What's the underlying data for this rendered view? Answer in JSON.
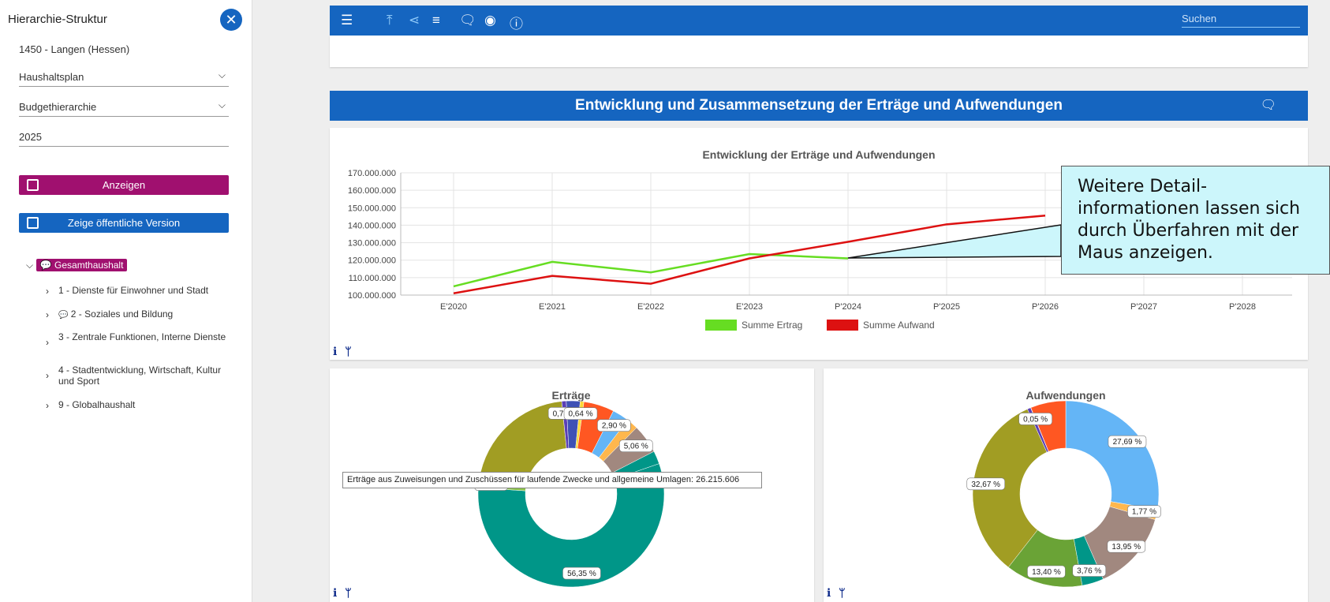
{
  "sidebar": {
    "title": "Hierarchie-Struktur",
    "municipality": "1450 - Langen (Hessen)",
    "plan_select": "Haushaltsplan",
    "hierarchy_select": "Budgethierarchie",
    "year_field": "2025",
    "show_button": "Anzeigen",
    "public_button": "Zeige öffentliche Version",
    "tree": {
      "root": "Gesamthaushalt",
      "items": [
        "1 - Dienste für Einwohner und Stadt",
        "2 - Soziales und Bildung",
        "3 - Zentrale Funktionen, Interne Dienste",
        "4 - Stadtentwicklung, Wirtschaft, Kultur und Sport",
        "9 - Globalhaushalt"
      ]
    }
  },
  "toolbar": {
    "search_placeholder": "Suchen",
    "icons": [
      "menu-icon",
      "upload-icon",
      "share-icon",
      "list-icon",
      "comment-icon",
      "eye-icon",
      "info-icon"
    ]
  },
  "section": {
    "title": "Entwicklung und Zusammensetzung der Erträge und Aufwendungen"
  },
  "callout_text": "Weitere Detail-informationen lassen sich durch Überfahren mit der Maus anzeigen.",
  "callout_lines": [
    "Weitere Detail-",
    "informationen lassen sich",
    "durch Überfahren mit der",
    "Maus anzeigen."
  ],
  "tooltip_text": "Erträge aus Zuweisungen und Zuschüssen für laufende Zwecke und allgemeine Umlagen: 26.215.606",
  "colors": {
    "primary": "#1565c0",
    "accent": "#a0106f",
    "ertrag": "#66dd22",
    "aufwand": "#dd1111"
  },
  "chart_data": [
    {
      "type": "line",
      "title": "Entwicklung der Erträge und Aufwendungen",
      "categories": [
        "E'2020",
        "E'2021",
        "E'2022",
        "E'2023",
        "P'2024",
        "P'2025",
        "P'2026",
        "P'2027",
        "P'2028"
      ],
      "ylim": [
        100000000,
        170000000
      ],
      "yticks": [
        "100.000.000",
        "110.000.000",
        "120.000.000",
        "130.000.000",
        "140.000.000",
        "150.000.000",
        "160.000.000",
        "170.000.000"
      ],
      "series": [
        {
          "name": "Summe Ertrag",
          "color": "#66dd22",
          "values": [
            105000000,
            119000000,
            113000000,
            123500000,
            121000000,
            null,
            null,
            null,
            null
          ]
        },
        {
          "name": "Summe Aufwand",
          "color": "#dd1111",
          "values": [
            101000000,
            111000000,
            106500000,
            121000000,
            130500000,
            140500000,
            145500000,
            null,
            null
          ]
        }
      ],
      "legend": "bottom",
      "grid": true
    },
    {
      "type": "pie",
      "title": "Erträge",
      "slices": [
        {
          "value": 56.35,
          "label": "56,35 %",
          "color": "#009688"
        },
        {
          "value": 1.44,
          "label": "1,44 %",
          "color": "#8bc34a"
        },
        {
          "value": 20.87,
          "label": "",
          "color": "#a19d23"
        },
        {
          "value": 0.78,
          "label": "0,78 %",
          "color": "#5a3fb5"
        },
        {
          "value": 2.4,
          "label": "",
          "color": "#3f51b5"
        },
        {
          "value": 0.64,
          "label": "0,64 %",
          "color": "#fdd835"
        },
        {
          "value": 5.3,
          "label": "",
          "color": "#ff5722"
        },
        {
          "value": 2.9,
          "label": "2,90 %",
          "color": "#64b5f6"
        },
        {
          "value": 2.0,
          "label": "",
          "color": "#ffb74d"
        },
        {
          "value": 5.06,
          "label": "5,06 %",
          "color": "#a1887f"
        },
        {
          "value": 2.26,
          "label": "",
          "color": "#009688"
        }
      ]
    },
    {
      "type": "pie",
      "title": "Aufwendungen",
      "slices": [
        {
          "value": 27.69,
          "label": "27,69 %",
          "color": "#64b5f6"
        },
        {
          "value": 1.77,
          "label": "1,77 %",
          "color": "#ffb74d"
        },
        {
          "value": 13.95,
          "label": "13,95 %",
          "color": "#a1887f"
        },
        {
          "value": 3.76,
          "label": "3,76 %",
          "color": "#009688"
        },
        {
          "value": 13.4,
          "label": "13,40 %",
          "color": "#6aa336"
        },
        {
          "value": 32.67,
          "label": "32,67 %",
          "color": "#a19d23"
        },
        {
          "value": 0.6,
          "label": "",
          "color": "#5a3fb5"
        },
        {
          "value": 0.05,
          "label": "0,05 %",
          "color": "#fdd835"
        },
        {
          "value": 6.11,
          "label": "",
          "color": "#ff5722"
        }
      ]
    }
  ]
}
